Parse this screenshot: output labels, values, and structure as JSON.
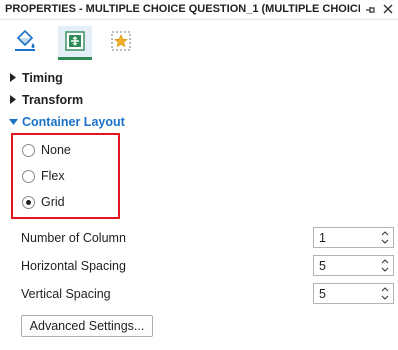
{
  "panel": {
    "title": "PROPERTIES - MULTIPLE CHOICE QUESTION_1 (MULTIPLE CHOICE ...",
    "pin_icon": "pin-icon",
    "close_icon": "close-icon"
  },
  "toolbar": {
    "tabs": [
      {
        "icon": "paint-bucket-icon",
        "active": false
      },
      {
        "icon": "container-layout-icon",
        "active": true
      },
      {
        "icon": "star-frame-icon",
        "active": false
      }
    ]
  },
  "sections": {
    "timing": "Timing",
    "transform": "Transform",
    "container_layout": "Container Layout"
  },
  "layout_options": [
    {
      "label": "None",
      "selected": false
    },
    {
      "label": "Flex",
      "selected": false
    },
    {
      "label": "Grid",
      "selected": true
    }
  ],
  "grid_props": [
    {
      "label": "Number of Column",
      "value": "1"
    },
    {
      "label": "Horizontal Spacing",
      "value": "5"
    },
    {
      "label": "Vertical Spacing",
      "value": "5"
    }
  ],
  "advanced_button": "Advanced Settings...",
  "colors": {
    "accent": "#1a73c7",
    "highlight": "#e0141e",
    "active_tab_underline": "#2e8b57"
  }
}
